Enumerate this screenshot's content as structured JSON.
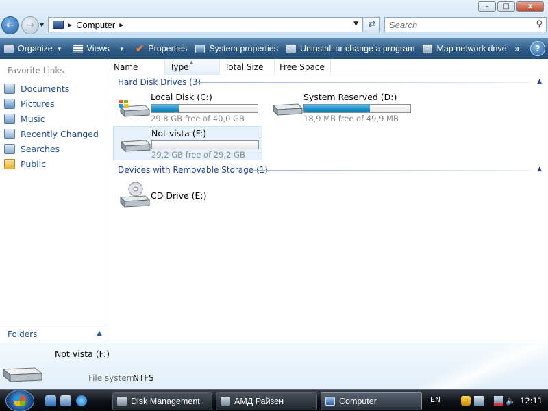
{
  "window": {
    "controls": {
      "minimize": "–",
      "maximize": "□",
      "close": "x"
    }
  },
  "nav": {
    "back_icon": "back-arrow-icon",
    "forward_icon": "forward-arrow-icon",
    "address_crumb": "Computer",
    "search_placeholder": "Search"
  },
  "toolbar": {
    "items": [
      {
        "label": "Organize",
        "icon": "organize-icon"
      },
      {
        "label": "Views",
        "icon": "views-icon"
      },
      {
        "label": "Properties",
        "icon": "checkmark-icon"
      },
      {
        "label": "System properties",
        "icon": "monitor-icon"
      },
      {
        "label": "Uninstall or change a program",
        "icon": "uninstall-icon"
      },
      {
        "label": "Map network drive",
        "icon": "network-drive-icon"
      }
    ],
    "more": "»",
    "help": "?"
  },
  "sidebar": {
    "favorites_title": "Favorite Links",
    "items": [
      {
        "label": "Documents",
        "icon": "documents-icon"
      },
      {
        "label": "Pictures",
        "icon": "pictures-icon"
      },
      {
        "label": "Music",
        "icon": "music-icon"
      },
      {
        "label": "Recently Changed",
        "icon": "recently-changed-icon"
      },
      {
        "label": "Searches",
        "icon": "searches-icon"
      },
      {
        "label": "Public",
        "icon": "public-folder-icon"
      }
    ],
    "folders_label": "Folders"
  },
  "columns": [
    "Name",
    "Type",
    "Total Size",
    "Free Space"
  ],
  "groups": {
    "hard_disks": {
      "title": "Hard Disk Drives (3)",
      "drives": [
        {
          "name": "Local Disk (C:)",
          "free_text": "29,8 GB free of 40,0 GB",
          "used_fraction": 0.255,
          "icon": "windows-drive-icon"
        },
        {
          "name": "System Reserved (D:)",
          "free_text": "18,9 MB free of 49,9 MB",
          "used_fraction": 0.62,
          "icon": "hard-drive-icon"
        },
        {
          "name": "Not vista (F:)",
          "free_text": "29,2 GB free of 29,2 GB",
          "used_fraction": 0.0,
          "icon": "hard-drive-icon"
        }
      ]
    },
    "removable": {
      "title": "Devices with Removable Storage (1)",
      "devices": [
        {
          "name": "CD Drive (E:)",
          "icon": "cd-drive-icon"
        }
      ]
    }
  },
  "details": {
    "name": "Not vista (F:)",
    "fs_label": "File system:",
    "fs_value": "NTFS"
  },
  "taskbar": {
    "tasks": [
      {
        "label": "Disk Management",
        "icon": "disk-management-icon"
      },
      {
        "label": "АМД Райзен",
        "icon": "window-icon"
      },
      {
        "label": "Computer",
        "icon": "computer-icon",
        "active": true
      }
    ],
    "language": "EN",
    "clock": "12:11"
  },
  "colors": {
    "accent": "#1f8fc2",
    "link": "#1f4f9e",
    "toolbar": "#2d5b86"
  }
}
